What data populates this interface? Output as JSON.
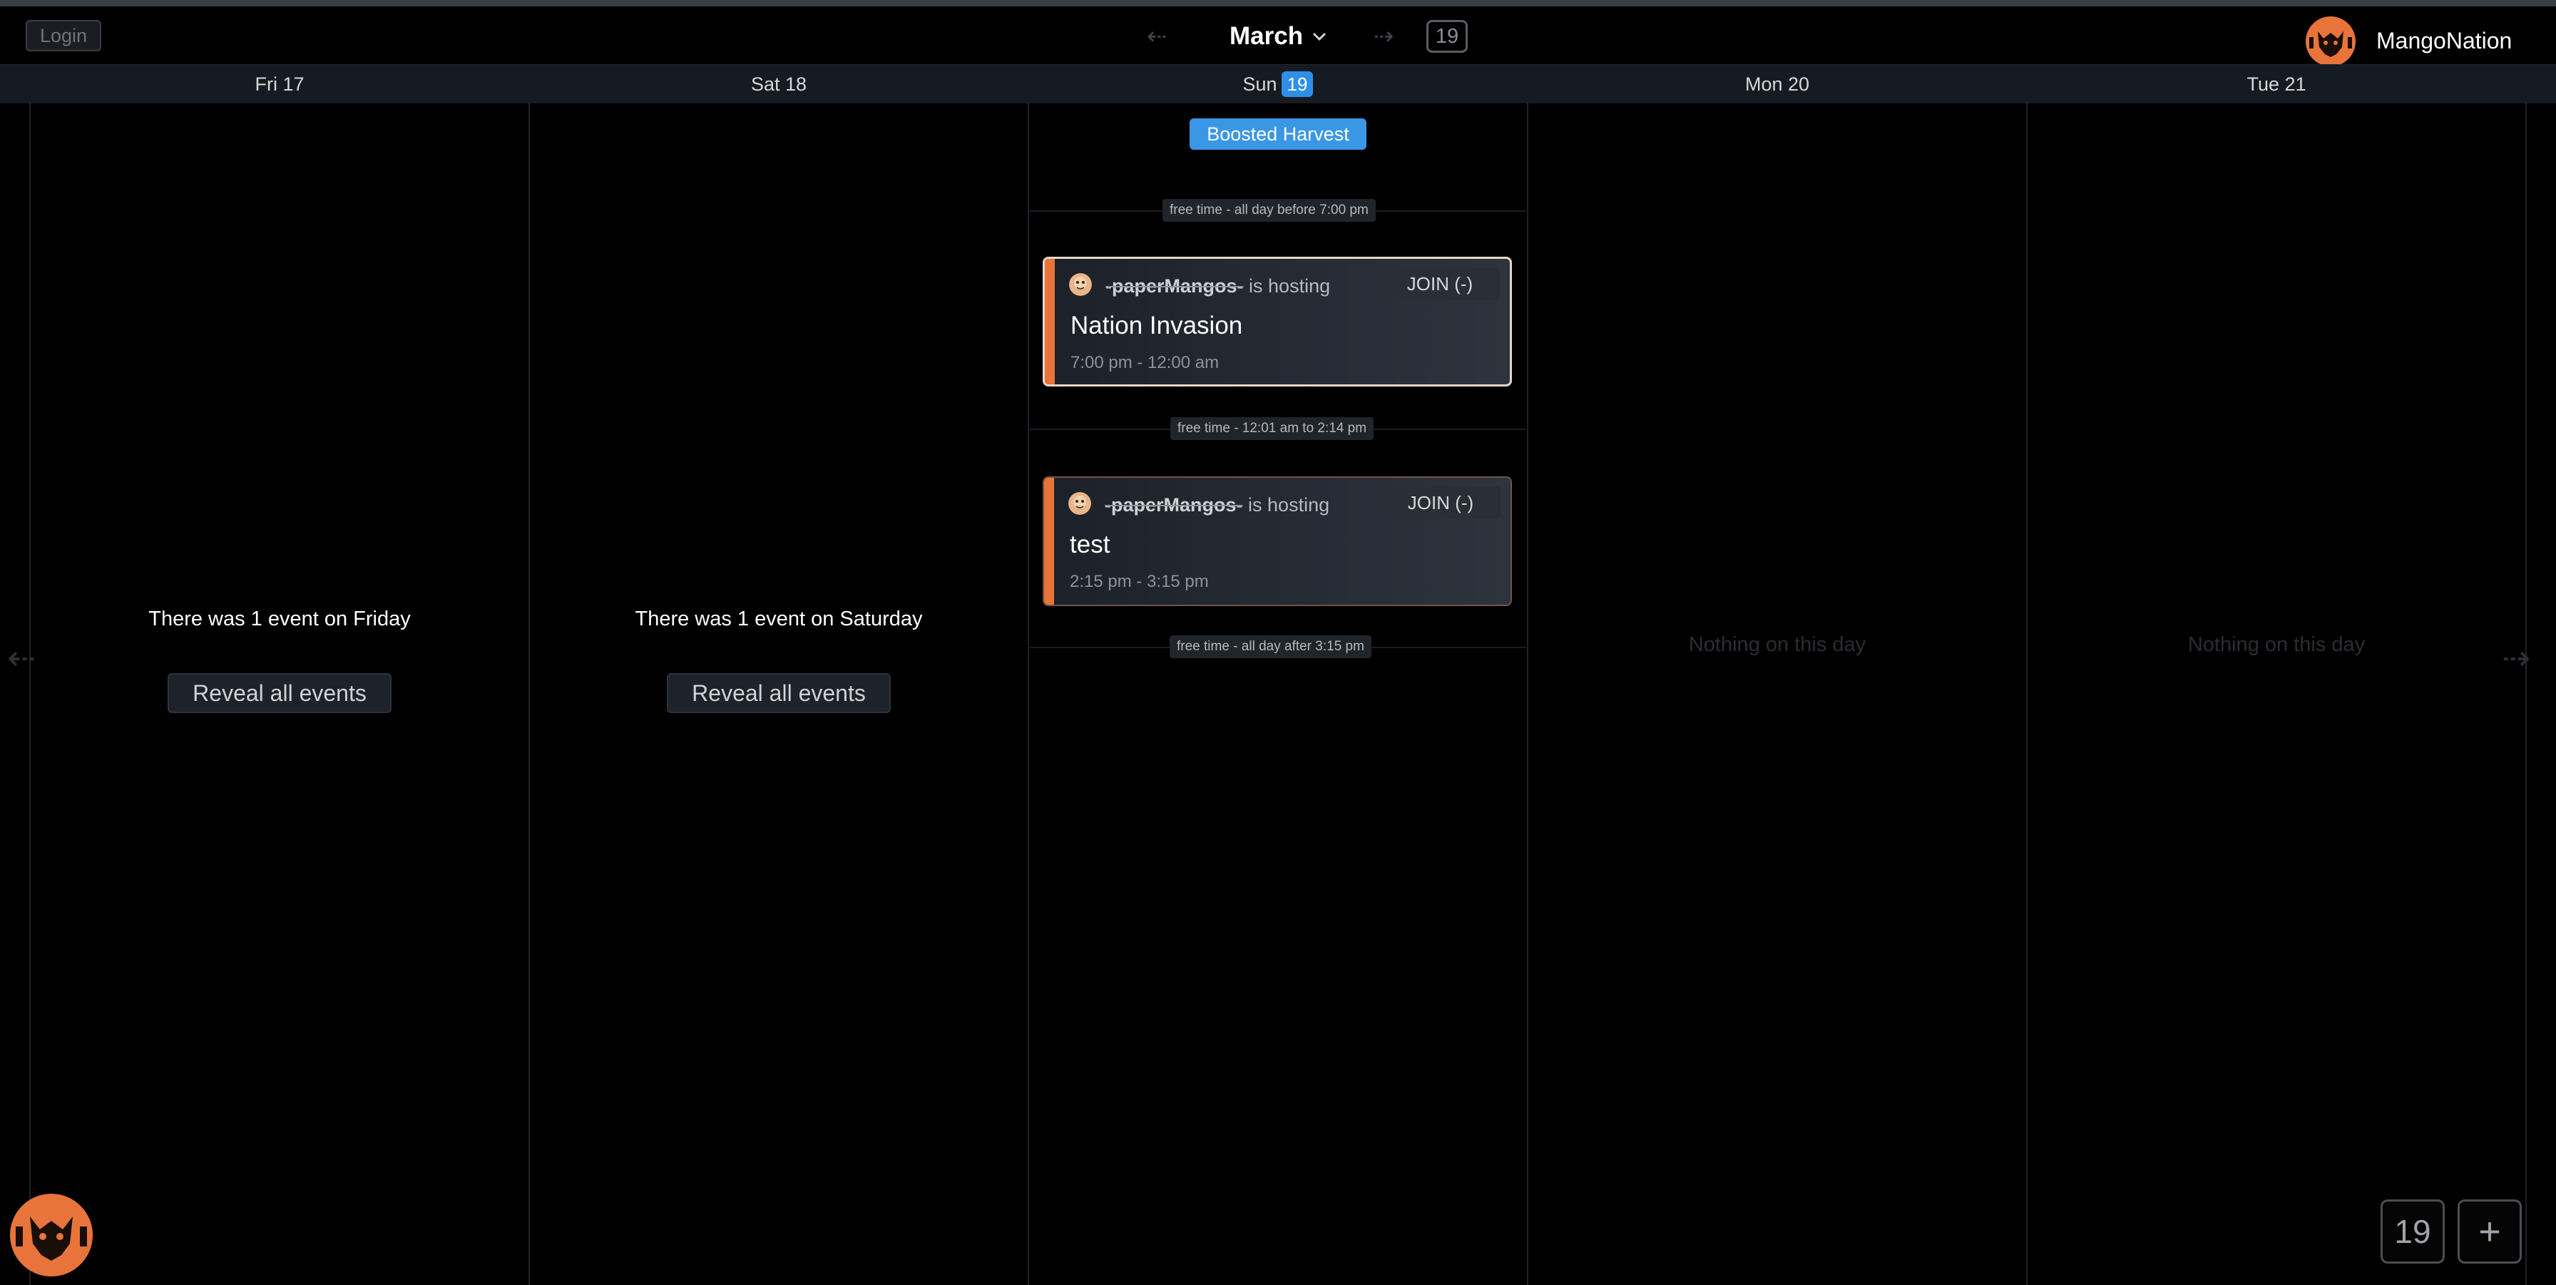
{
  "topbar": {
    "login_label": "Login",
    "prev_arrow": "⇠",
    "month": "March",
    "next_arrow": "⇢",
    "today_badge": "19",
    "brand_name": "MangoNation"
  },
  "days": [
    {
      "label": "Fri 17",
      "summary": "There was 1 event on Friday",
      "reveal_label": "Reveal all events"
    },
    {
      "label": "Sat 18",
      "summary": "There was 1 event on Saturday",
      "reveal_label": "Reveal all events"
    },
    {
      "label": "Sun",
      "num": "19"
    },
    {
      "label": "Mon 20",
      "empty": "Nothing on this day"
    },
    {
      "label": "Tue 21",
      "empty": "Nothing on this day"
    }
  ],
  "today": {
    "banner": "Boosted Harvest",
    "free_slots": [
      "free time - all day before 7:00 pm",
      "free time - 12:01 am to 2:14 pm",
      "free time - all day after 3:15 pm"
    ],
    "events": [
      {
        "host": "-paperMangos-",
        "hosting_text": "is hosting",
        "join_label": "JOIN (-)",
        "title": "Nation Invasion",
        "time": "7:00 pm - 12:00 am"
      },
      {
        "host": "-paperMangos-",
        "hosting_text": "is hosting",
        "join_label": "JOIN (-)",
        "title": "test",
        "time": "2:15 pm - 3:15 pm"
      }
    ]
  },
  "side_nav": {
    "left": "⇠",
    "right": "⇢"
  },
  "bottom": {
    "today_label": "19",
    "add_label": "+"
  },
  "colors": {
    "accent": "#e8743b",
    "today_blue": "#2f8fe8",
    "background": "#000000"
  }
}
